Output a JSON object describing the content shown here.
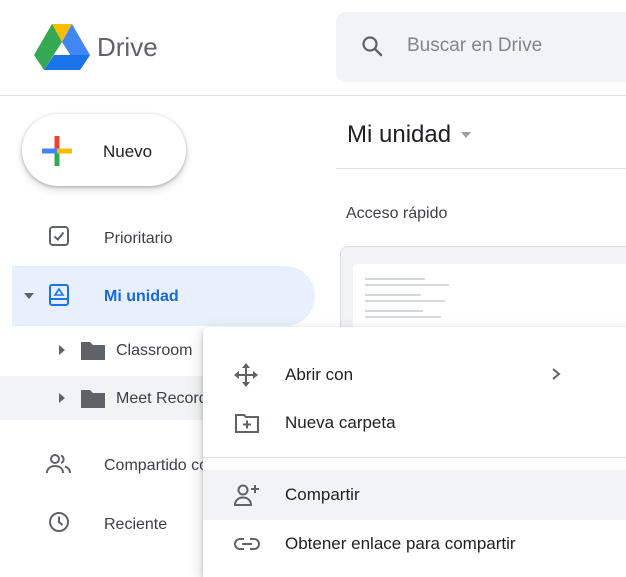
{
  "header": {
    "brand": "Drive",
    "search_placeholder": "Buscar en Drive"
  },
  "new_button": {
    "label": "Nuevo"
  },
  "sidebar": {
    "items": [
      {
        "label": "Prioritario",
        "icon": "priority-check-icon"
      },
      {
        "label": "Mi unidad",
        "icon": "my-drive-icon",
        "selected": true
      },
      {
        "label": "Compartido conmigo",
        "icon": "shared-people-icon"
      },
      {
        "label": "Reciente",
        "icon": "clock-icon"
      }
    ],
    "folders": [
      {
        "label": "Classroom",
        "icon": "folder-icon"
      },
      {
        "label": "Meet Recordings",
        "icon": "folder-icon"
      }
    ]
  },
  "main": {
    "title": "Mi unidad",
    "quick_access": "Acceso rápido",
    "peek_text": "08"
  },
  "context_menu": {
    "items": [
      {
        "label": "Abrir con",
        "icon": "move-arrows-icon",
        "submenu": true
      },
      {
        "label": "Nueva carpeta",
        "icon": "new-folder-icon"
      },
      {
        "label": "Compartir",
        "icon": "share-person-add-icon",
        "hovered": true
      },
      {
        "label": "Obtener enlace para compartir",
        "icon": "link-icon"
      }
    ]
  },
  "colors": {
    "accent_blue": "#1a73e8",
    "selected_bg": "#e8f0fe",
    "hover_bg": "#f1f3f4",
    "google_green": "#34a853",
    "google_yellow": "#fbbc04",
    "google_red": "#ea4335"
  }
}
